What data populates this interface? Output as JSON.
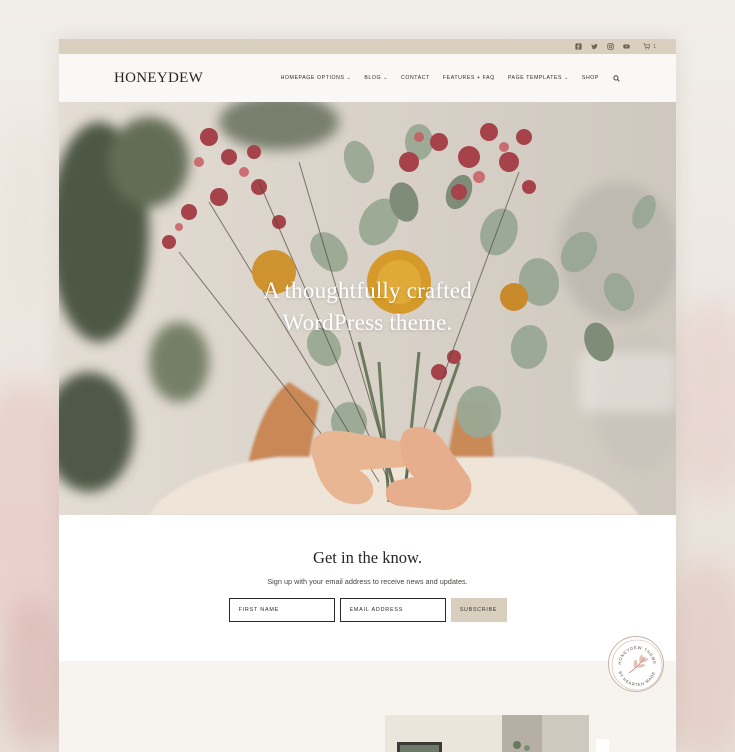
{
  "site": {
    "logo": "HONEYDEW"
  },
  "topbar": {
    "icons": [
      "facebook-icon",
      "twitter-icon",
      "instagram-icon",
      "youtube-icon"
    ],
    "cart_icon": "cart-icon",
    "cart_count": "1"
  },
  "nav": {
    "items": [
      {
        "label": "HOMEPAGE OPTIONS",
        "dropdown": true
      },
      {
        "label": "BLOG",
        "dropdown": true
      },
      {
        "label": "CONTACT",
        "dropdown": false
      },
      {
        "label": "FEATURES + FAQ",
        "dropdown": false
      },
      {
        "label": "PAGE TEMPLATES",
        "dropdown": true
      },
      {
        "label": "SHOP",
        "dropdown": false
      }
    ],
    "search_icon": "search-icon"
  },
  "hero": {
    "headline_line1": "A thoughtfully crafted",
    "headline_line2": "WordPress theme."
  },
  "signup": {
    "title": "Get in the know.",
    "description": "Sign up with your email address to receive news and updates.",
    "first_name_placeholder": "FIRST NAME",
    "email_placeholder": "EMAIL ADDRESS",
    "subscribe_label": "SUBSCRIBE"
  },
  "badge": {
    "top_text": "HONEYDEW THEME",
    "bottom_text": "BY HEARTEN MADE"
  },
  "colors": {
    "topbar": "#d9d0c0",
    "header_bg": "#f9f8f6",
    "subscribe_bg": "#d8cfbf",
    "text_dark": "#2b2622",
    "accent_blush": "#c98a7c"
  }
}
